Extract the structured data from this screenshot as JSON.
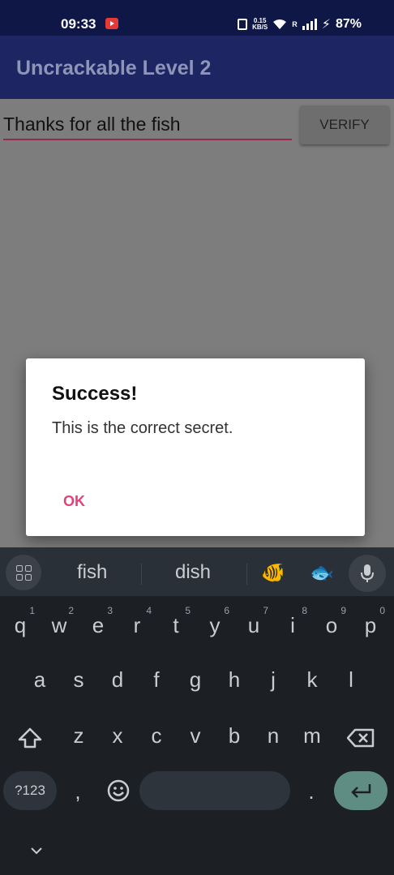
{
  "status_bar": {
    "time": "09:33",
    "speed_value": "0.15",
    "speed_unit": "KB/S",
    "network": "R",
    "battery": "87%"
  },
  "app_bar": {
    "title": "Uncrackable Level 2"
  },
  "form": {
    "secret_value": "Thanks for all the fish",
    "verify_label": "VERIFY"
  },
  "dialog": {
    "title": "Success!",
    "message": "This is the correct secret.",
    "ok_label": "OK"
  },
  "keyboard": {
    "suggestions": [
      "fish",
      "dish"
    ],
    "emoji_suggestions": [
      "tropical-fish",
      "fish"
    ],
    "row1": [
      {
        "key": "q",
        "hint": "1"
      },
      {
        "key": "w",
        "hint": "2"
      },
      {
        "key": "e",
        "hint": "3"
      },
      {
        "key": "r",
        "hint": "4"
      },
      {
        "key": "t",
        "hint": "5"
      },
      {
        "key": "y",
        "hint": "6"
      },
      {
        "key": "u",
        "hint": "7"
      },
      {
        "key": "i",
        "hint": "8"
      },
      {
        "key": "o",
        "hint": "9"
      },
      {
        "key": "p",
        "hint": "0"
      }
    ],
    "row2": [
      "a",
      "s",
      "d",
      "f",
      "g",
      "h",
      "j",
      "k",
      "l"
    ],
    "row3": [
      "z",
      "x",
      "c",
      "v",
      "b",
      "n",
      "m"
    ],
    "symbols_label": "?123",
    "comma": ",",
    "period": "."
  },
  "colors": {
    "status_bar": "#0f1746",
    "app_bar": "#1d2663",
    "accent": "#e34277",
    "enter_key": "#5f8d83"
  }
}
